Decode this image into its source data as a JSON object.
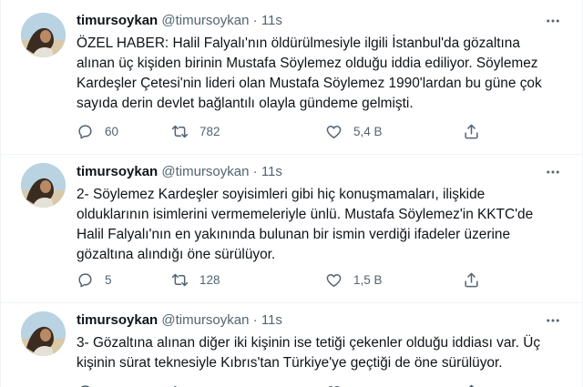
{
  "tweets": [
    {
      "name": "timursoykan",
      "handle": "@timursoykan",
      "separator": "·",
      "time": "11s",
      "text": "ÖZEL HABER: Halil Falyalı'nın öldürülmesiyle ilgili İstanbul'da gözaltına alınan üç kişiden birinin Mustafa Söylemez olduğu iddia ediliyor. Söylemez Kardeşler Çetesi'nin lideri olan Mustafa Söylemez 1990'lardan bu güne çok sayıda derin devlet bağlantılı olayla gündeme gelmişti.",
      "replies": "60",
      "retweets": "782",
      "likes": "5,4 B"
    },
    {
      "name": "timursoykan",
      "handle": "@timursoykan",
      "separator": "·",
      "time": "11s",
      "text": "2- Söylemez Kardeşler soyisimleri gibi hiç konuşmamaları, ilişkide olduklarının isimlerini vermemeleriyle ünlü. Mustafa Söylemez'in KKTC'de Halil Falyalı'nın en yakınında bulunan bir ismin verdiği ifadeler üzerine gözaltına alındığı öne sürülüyor.",
      "replies": "5",
      "retweets": "128",
      "likes": "1,5 B"
    },
    {
      "name": "timursoykan",
      "handle": "@timursoykan",
      "separator": "·",
      "time": "11s",
      "text": "3- Gözaltına alınan diğer iki kişinin ise tetiği çekenler olduğu iddiası var. Üç kişinin sürat teknesiyle Kıbrıs'tan Türkiye'ye geçtiği de öne sürülüyor.",
      "replies": "",
      "retweets": "",
      "likes": ""
    }
  ],
  "icons": {
    "reply": "reply-icon",
    "retweet": "retweet-icon",
    "like": "like-icon",
    "share": "share-icon",
    "more": "more-icon"
  },
  "colors": {
    "text": "#0f1419",
    "secondary": "#536471",
    "divider": "#eff3f4"
  }
}
